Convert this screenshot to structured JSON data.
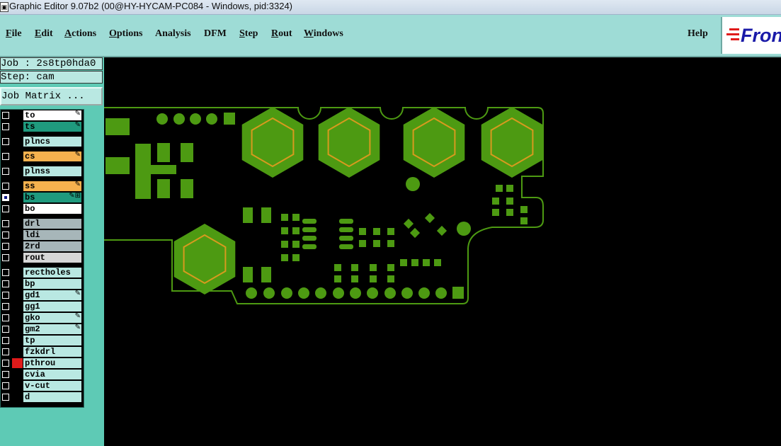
{
  "window": {
    "icon_glyph": "▣",
    "title": "Graphic Editor 9.07b2 (00@HY-HYCAM-PC084 - Windows, pid:3324)"
  },
  "menu": {
    "items": [
      {
        "label": "File",
        "underline": "F",
        "rest": "ile"
      },
      {
        "label": "Edit",
        "underline": "E",
        "rest": "dit"
      },
      {
        "label": "Actions",
        "underline": "A",
        "rest": "ctions"
      },
      {
        "label": "Options",
        "underline": "O",
        "rest": "ptions"
      },
      {
        "label": "Analysis",
        "underline": "",
        "rest": "Analysis"
      },
      {
        "label": "DFM",
        "underline": "",
        "rest": "DFM"
      },
      {
        "label": "Step",
        "underline": "S",
        "rest": "tep"
      },
      {
        "label": "Rout",
        "underline": "R",
        "rest": "out"
      },
      {
        "label": "Windows",
        "underline": "W",
        "rest": "indows"
      }
    ],
    "help": "Help",
    "logo_text": "Fron"
  },
  "job": {
    "job_line": "Job : 2s8tp0hda0",
    "step_line": "Step: cam",
    "matrix_button": "Job Matrix ..."
  },
  "layers": [
    {
      "name": "to",
      "color": "#ffffff",
      "mark": "✎",
      "sw": "#000"
    },
    {
      "name": "ts",
      "color": "#1f9a7e",
      "mark": "✎",
      "sw": "#000"
    },
    {
      "name": "plncs",
      "color": "#b9e8e2",
      "mark": "",
      "sw": "#000"
    },
    {
      "name": "cs",
      "color": "#f5b14e",
      "mark": "✎",
      "sw": "#000"
    },
    {
      "name": "plnss",
      "color": "#b9e8e2",
      "mark": "",
      "sw": "#000"
    },
    {
      "name": "ss",
      "color": "#f5b14e",
      "mark": "✎",
      "sw": "#000"
    },
    {
      "name": "bs",
      "color": "#1f9a7e",
      "mark": "✎⊞",
      "sw": "#000",
      "checked": true
    },
    {
      "name": "bo",
      "color": "#ffffff",
      "mark": "",
      "sw": "#000"
    },
    {
      "name": "drl",
      "color": "#a7b6b9",
      "mark": "",
      "sw": "#000"
    },
    {
      "name": "ldi",
      "color": "#a7b6b9",
      "mark": "",
      "sw": "#000"
    },
    {
      "name": "2rd",
      "color": "#a7b6b9",
      "mark": "",
      "sw": "#000"
    },
    {
      "name": "rout",
      "color": "#d6d6d6",
      "mark": "",
      "sw": "#000"
    },
    {
      "name": "rectholes",
      "color": "#b9e8e2",
      "mark": "",
      "sw": "#000"
    },
    {
      "name": "bp",
      "color": "#b9e8e2",
      "mark": "",
      "sw": "#000"
    },
    {
      "name": "gd1",
      "color": "#b9e8e2",
      "mark": "✎",
      "sw": "#000"
    },
    {
      "name": "gg1",
      "color": "#b9e8e2",
      "mark": "",
      "sw": "#000"
    },
    {
      "name": "gko",
      "color": "#b9e8e2",
      "mark": "✎",
      "sw": "#000"
    },
    {
      "name": "gm2",
      "color": "#b9e8e2",
      "mark": "✎",
      "sw": "#000"
    },
    {
      "name": "tp",
      "color": "#b9e8e2",
      "mark": "",
      "sw": "#000"
    },
    {
      "name": "fzkdrl",
      "color": "#b9e8e2",
      "mark": "",
      "sw": "#000"
    },
    {
      "name": "pthrou",
      "color": "#b9e8e2",
      "mark": "",
      "sw": "#e01a1a"
    },
    {
      "name": "cvia",
      "color": "#b9e8e2",
      "mark": "",
      "sw": "#000"
    },
    {
      "name": "v-cut",
      "color": "#b9e8e2",
      "mark": "",
      "sw": "#000"
    },
    {
      "name": "d",
      "color": "#b9e8e2",
      "mark": "",
      "sw": "#000"
    }
  ],
  "colors": {
    "pcb_copper": "#4d9a12",
    "pcb_outline": "#4d9a12",
    "hex_inner": "#d79a1e",
    "canvas_bg": "#000000"
  }
}
